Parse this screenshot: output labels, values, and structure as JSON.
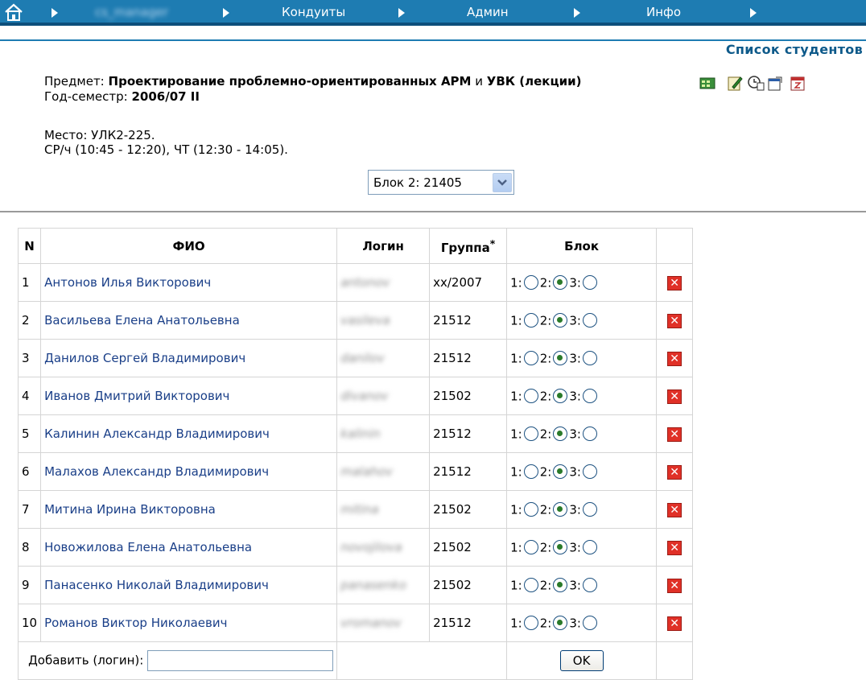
{
  "nav": {
    "user_label": "cs_manager",
    "items": [
      {
        "label": "Кондуиты"
      },
      {
        "label": "Админ"
      },
      {
        "label": "Инфо"
      }
    ]
  },
  "page_title": "Список студентов",
  "info": {
    "subject_label": "Предмет:",
    "subject_value": "Проектирование проблемно-ориентированных АРМ",
    "subject_and": "и",
    "subject_value2": "УВК (лекции)",
    "semester_label": "Год-семестр:",
    "semester_value": "2006/07 II",
    "place": "Место: УЛК2-225.",
    "schedule": "СР/ч (10:45 - 12:20), ЧТ (12:30 - 14:05)."
  },
  "block_select": {
    "selected": "Блок 2: 21405"
  },
  "table": {
    "headers": {
      "n": "N",
      "fio": "ФИО",
      "login": "Логин",
      "group": "Группа",
      "group_mark": "*",
      "block": "Блок"
    },
    "rows": [
      {
        "n": "1",
        "name": "Антонов Илья Викторович",
        "login": "antonov",
        "group": "xx/2007",
        "block": 2
      },
      {
        "n": "2",
        "name": "Васильева Елена Анатольевна",
        "login": "vasileva",
        "group": "21512",
        "block": 2
      },
      {
        "n": "3",
        "name": "Данилов Сергей Владимирович",
        "login": "danilov",
        "group": "21512",
        "block": 2
      },
      {
        "n": "4",
        "name": "Иванов Дмитрий Викторович",
        "login": "divanov",
        "group": "21502",
        "block": 2
      },
      {
        "n": "5",
        "name": "Калинин Александр Владимирович",
        "login": "kalinin",
        "group": "21512",
        "block": 2
      },
      {
        "n": "6",
        "name": "Малахов Александр Владимирович",
        "login": "malahov",
        "group": "21512",
        "block": 2
      },
      {
        "n": "7",
        "name": "Митина Ирина Викторовна",
        "login": "mitina",
        "group": "21502",
        "block": 2
      },
      {
        "n": "8",
        "name": "Новожилова Елена Анатольевна",
        "login": "novojilova",
        "group": "21502",
        "block": 2
      },
      {
        "n": "9",
        "name": "Панасенко Николай Владимирович",
        "login": "panasenko",
        "group": "21502",
        "block": 2
      },
      {
        "n": "10",
        "name": "Романов Виктор Николаевич",
        "login": "vromanov",
        "group": "21512",
        "block": 2
      }
    ],
    "radio_labels": [
      "1:",
      "2:",
      "3:"
    ],
    "delete_glyph": "✕"
  },
  "add_form": {
    "label": "Добавить (логин):",
    "value": "",
    "ok_label": "OK"
  },
  "colors": {
    "nav_bar": "#1e7cb2",
    "link": "#1a3f88",
    "title": "#0e5a8a",
    "delete": "#e03027"
  }
}
